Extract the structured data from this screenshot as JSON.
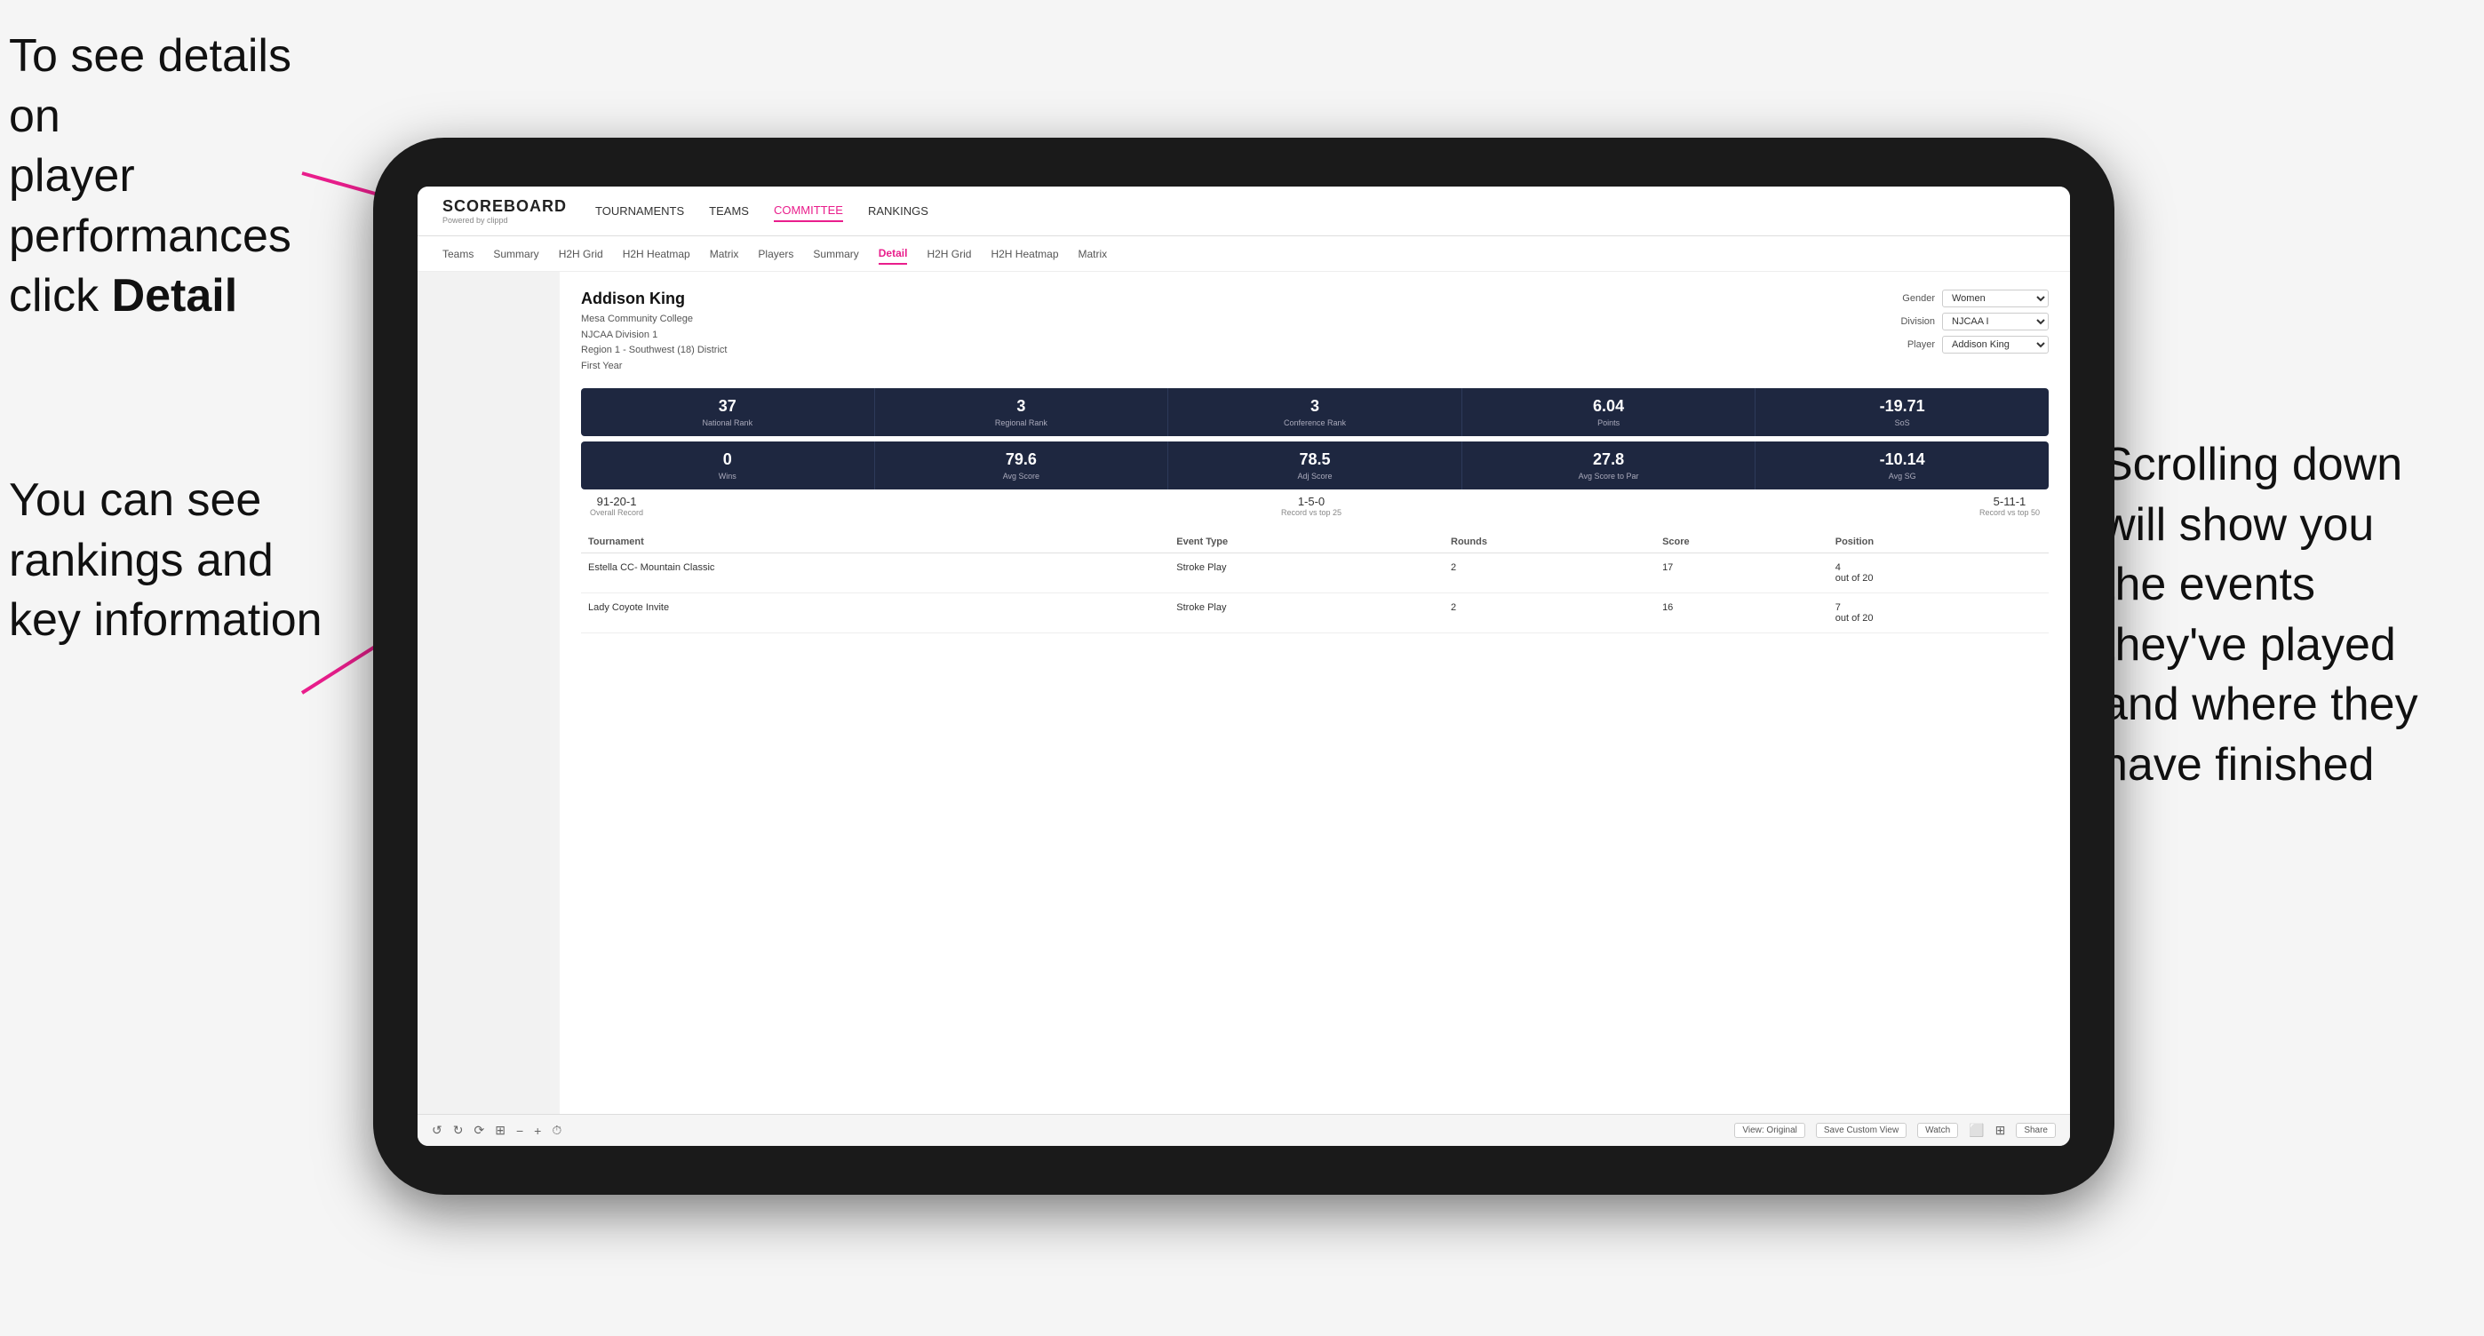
{
  "annotations": {
    "top_left": {
      "line1": "To see details on",
      "line2": "player performances",
      "line3": "click ",
      "line3_bold": "Detail"
    },
    "bottom_left": {
      "line1": "You can see",
      "line2": "rankings and",
      "line3": "key information"
    },
    "right": {
      "line1": "Scrolling down",
      "line2": "will show you",
      "line3": "the events",
      "line4": "they've played",
      "line5": "and where they",
      "line6": "have finished"
    }
  },
  "nav": {
    "logo": "SCOREBOARD",
    "powered_by": "Powered by clippd",
    "top_links": [
      "TOURNAMENTS",
      "TEAMS",
      "COMMITTEE",
      "RANKINGS"
    ],
    "sub_links": [
      "Teams",
      "Summary",
      "H2H Grid",
      "H2H Heatmap",
      "Matrix",
      "Players",
      "Summary",
      "Detail",
      "H2H Grid",
      "H2H Heatmap",
      "Matrix"
    ]
  },
  "player": {
    "name": "Addison King",
    "college": "Mesa Community College",
    "division": "NJCAA Division 1",
    "region": "Region 1 - Southwest (18) District",
    "year": "First Year"
  },
  "filters": {
    "gender_label": "Gender",
    "gender_value": "Women",
    "division_label": "Division",
    "division_value": "NJCAA I",
    "player_label": "Player",
    "player_value": "Addison King"
  },
  "stats_row1": [
    {
      "value": "37",
      "label": "National Rank"
    },
    {
      "value": "3",
      "label": "Regional Rank"
    },
    {
      "value": "3",
      "label": "Conference Rank"
    },
    {
      "value": "6.04",
      "label": "Points"
    },
    {
      "value": "-19.71",
      "label": "SoS"
    }
  ],
  "stats_row2": [
    {
      "value": "0",
      "label": "Wins"
    },
    {
      "value": "79.6",
      "label": "Avg Score"
    },
    {
      "value": "78.5",
      "label": "Adj Score"
    },
    {
      "value": "27.8",
      "label": "Avg Score to Par"
    },
    {
      "value": "-10.14",
      "label": "Avg SG"
    }
  ],
  "records": [
    {
      "value": "91-20-1",
      "label": "Overall Record"
    },
    {
      "value": "1-5-0",
      "label": "Record vs top 25"
    },
    {
      "value": "5-11-1",
      "label": "Record vs top 50"
    }
  ],
  "table": {
    "headers": [
      "Tournament",
      "Event Type",
      "Rounds",
      "Score",
      "Position"
    ],
    "rows": [
      {
        "tournament": "Estella CC- Mountain Classic",
        "event_type": "Stroke Play",
        "rounds": "2",
        "score": "17",
        "position": "4 out of 20"
      },
      {
        "tournament": "Lady Coyote Invite",
        "event_type": "Stroke Play",
        "rounds": "2",
        "score": "16",
        "position": "7 out of 20"
      }
    ]
  },
  "toolbar": {
    "view_original": "View: Original",
    "save_custom": "Save Custom View",
    "watch": "Watch",
    "share": "Share"
  }
}
